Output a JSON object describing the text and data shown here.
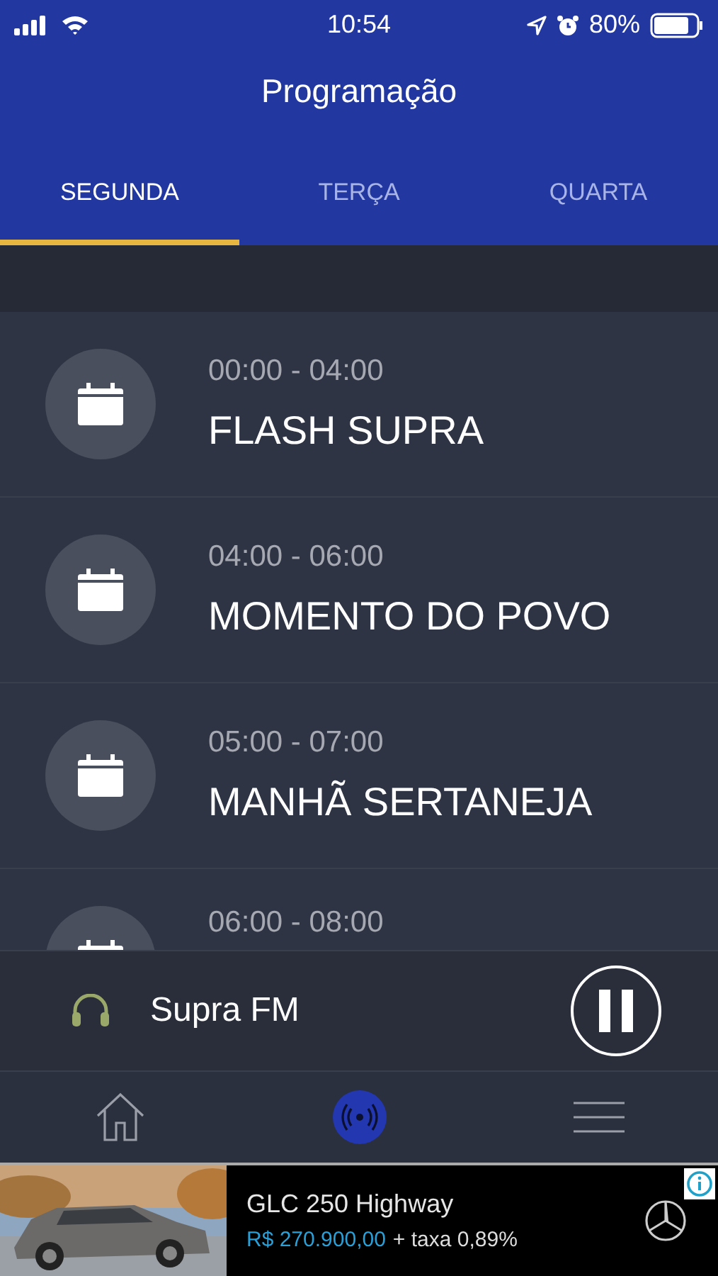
{
  "status_bar": {
    "time": "10:54",
    "battery": "80%"
  },
  "header": {
    "title": "Programação"
  },
  "tabs": [
    {
      "label": "SEGUNDA",
      "selected": true
    },
    {
      "label": "TERÇA",
      "selected": false
    },
    {
      "label": "QUARTA",
      "selected": false
    }
  ],
  "schedule": [
    {
      "time": "00:00 - 04:00",
      "title": "FLASH SUPRA"
    },
    {
      "time": "04:00 - 06:00",
      "title": "MOMENTO DO POVO"
    },
    {
      "time": "05:00 - 07:00",
      "title": "MANHÃ SERTANEJA"
    },
    {
      "time": "06:00 - 08:00"
    }
  ],
  "player": {
    "station": "Supra FM",
    "playing": true
  },
  "bottom_nav": [
    {
      "kind": "home",
      "selected": false
    },
    {
      "kind": "radio",
      "selected": true
    },
    {
      "kind": "menu",
      "selected": false
    }
  ],
  "ad": {
    "title": "GLC 250 Highway",
    "price": "R$ 270.900,00",
    "rate": "+ taxa 0,89%"
  }
}
